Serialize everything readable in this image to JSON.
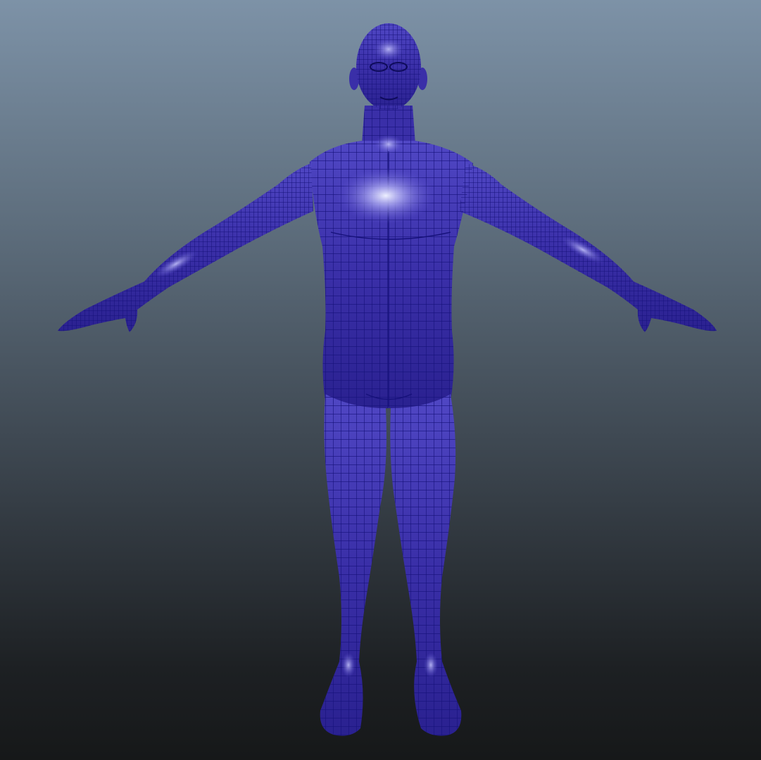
{
  "viewport": {
    "background_top": "#7d92a7",
    "background_bottom": "#161819"
  },
  "model": {
    "display_mode": "wireframe-on-shaded",
    "pose": "A-pose",
    "body_color": "#3a2fa8",
    "wire_color": "#16117a",
    "highlight_color": "#e8ecff"
  }
}
